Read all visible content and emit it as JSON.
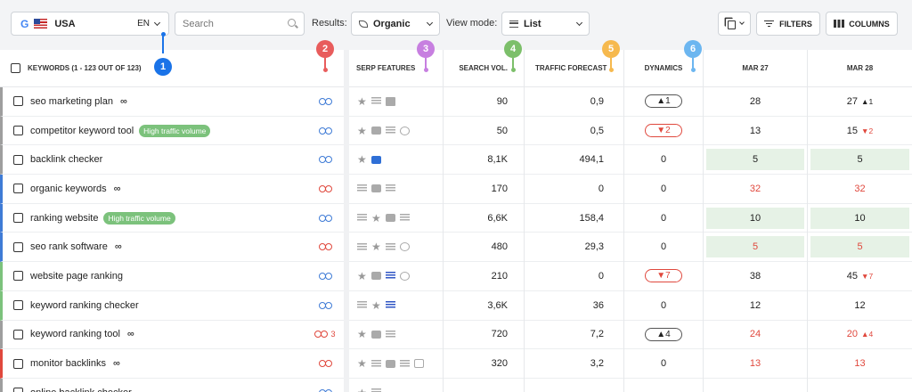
{
  "toolbar": {
    "search_engine_icon": "G",
    "country": "USA",
    "language": "EN",
    "search_placeholder": "Search",
    "results_label": "Results:",
    "results_value": "Organic",
    "view_mode_label": "View mode:",
    "view_mode_value": "List",
    "filters_label": "FILTERS",
    "columns_label": "COLUMNS"
  },
  "markers": [
    "1",
    "2",
    "3",
    "4",
    "5",
    "6"
  ],
  "table": {
    "headers": {
      "keywords": "KEYWORDS (1 - 123 OUT OF 123)",
      "serp": "SERP FEATURES",
      "volume": "SEARCH VOL.",
      "forecast": "TRAFFIC FORECAST",
      "dynamics": "DYNAMICS",
      "date1": "MAR 27",
      "date2": "MAR 28"
    },
    "rows": [
      {
        "keyword": "seo marketing plan",
        "inf": "∞",
        "badge": "",
        "link": "blue",
        "link_count": "",
        "serp": [
          "star",
          "list",
          "img"
        ],
        "volume": "90",
        "forecast": "0,9",
        "dyn": "▲1",
        "dyn_dir": "up",
        "d1": "28",
        "d1_style": "",
        "d2": "27",
        "d2_delta": "▲1",
        "d2_dir": "up",
        "d2_style": "",
        "accent": "#9e9e9e"
      },
      {
        "keyword": "competitor keyword tool",
        "inf": "",
        "badge": "High traffic volume",
        "link": "blue",
        "link_count": "",
        "serp": [
          "star",
          "video",
          "list",
          "circle"
        ],
        "volume": "50",
        "forecast": "0,5",
        "dyn": "▼2",
        "dyn_dir": "down",
        "d1": "13",
        "d1_style": "",
        "d2": "15",
        "d2_delta": "▼2",
        "d2_dir": "down",
        "d2_style": "",
        "accent": "#9e9e9e"
      },
      {
        "keyword": "backlink checker",
        "inf": "",
        "badge": "",
        "link": "blue",
        "link_count": "",
        "serp": [
          "star",
          "videoblue"
        ],
        "volume": "8,1K",
        "forecast": "494,1",
        "dyn": "0",
        "dyn_dir": "",
        "d1": "5",
        "d1_style": "green",
        "d2": "5",
        "d2_delta": "",
        "d2_dir": "",
        "d2_style": "green",
        "accent": "#9e9e9e"
      },
      {
        "keyword": "organic keywords",
        "inf": "∞",
        "badge": "",
        "link": "red",
        "link_count": "",
        "serp": [
          "list",
          "video",
          "list"
        ],
        "volume": "170",
        "forecast": "0",
        "dyn": "0",
        "dyn_dir": "",
        "d1": "32",
        "d1_style": "red",
        "d2": "32",
        "d2_delta": "",
        "d2_dir": "",
        "d2_style": "red",
        "accent": "#3f7bd6"
      },
      {
        "keyword": "ranking website",
        "inf": "",
        "badge": "High traffic volume",
        "link": "blue",
        "link_count": "",
        "serp": [
          "list",
          "star",
          "video",
          "list"
        ],
        "volume": "6,6K",
        "forecast": "158,4",
        "dyn": "0",
        "dyn_dir": "",
        "d1": "10",
        "d1_style": "green",
        "d2": "10",
        "d2_delta": "",
        "d2_dir": "",
        "d2_style": "green",
        "accent": "#3f7bd6"
      },
      {
        "keyword": "seo rank software",
        "inf": "∞",
        "badge": "",
        "link": "red",
        "link_count": "",
        "serp": [
          "list",
          "star",
          "list",
          "circle"
        ],
        "volume": "480",
        "forecast": "29,3",
        "dyn": "0",
        "dyn_dir": "",
        "d1": "5",
        "d1_style": "green red",
        "d2": "5",
        "d2_delta": "",
        "d2_dir": "",
        "d2_style": "green red",
        "accent": "#3f7bd6"
      },
      {
        "keyword": "website page ranking",
        "inf": "",
        "badge": "",
        "link": "blue",
        "link_count": "",
        "serp": [
          "star",
          "video",
          "listblue",
          "circle"
        ],
        "volume": "210",
        "forecast": "0",
        "dyn": "▼7",
        "dyn_dir": "down",
        "d1": "38",
        "d1_style": "",
        "d2": "45",
        "d2_delta": "▼7",
        "d2_dir": "down",
        "d2_style": "",
        "accent": "#7cc27c"
      },
      {
        "keyword": "keyword ranking checker",
        "inf": "",
        "badge": "",
        "link": "blue",
        "link_count": "",
        "serp": [
          "list",
          "star",
          "listblue"
        ],
        "volume": "3,6K",
        "forecast": "36",
        "dyn": "0",
        "dyn_dir": "",
        "d1": "12",
        "d1_style": "",
        "d2": "12",
        "d2_delta": "",
        "d2_dir": "",
        "d2_style": "",
        "accent": "#7cc27c"
      },
      {
        "keyword": "keyword ranking tool",
        "inf": "∞",
        "badge": "",
        "link": "red",
        "link_count": "3",
        "serp": [
          "star",
          "video",
          "list"
        ],
        "volume": "720",
        "forecast": "7,2",
        "dyn": "▲4",
        "dyn_dir": "up",
        "d1": "24",
        "d1_style": "red",
        "d2": "20",
        "d2_delta": "▲4",
        "d2_dir": "up",
        "d2_style": "red",
        "accent": "#9e9e9e"
      },
      {
        "keyword": "monitor backlinks",
        "inf": "∞",
        "badge": "",
        "link": "red",
        "link_count": "",
        "serp": [
          "star",
          "list",
          "video",
          "list",
          "box"
        ],
        "volume": "320",
        "forecast": "3,2",
        "dyn": "0",
        "dyn_dir": "",
        "d1": "13",
        "d1_style": "red",
        "d2": "13",
        "d2_delta": "",
        "d2_dir": "",
        "d2_style": "red",
        "accent": "#e0483d"
      },
      {
        "keyword": "online backlink checker",
        "inf": "",
        "badge": "",
        "link": "blue",
        "link_count": "",
        "serp": [
          "star",
          "list"
        ],
        "volume": "",
        "forecast": "",
        "dyn": "",
        "dyn_dir": "",
        "d1": "",
        "d1_style": "",
        "d2": "",
        "d2_delta": "",
        "d2_dir": "",
        "d2_style": "",
        "accent": "#9e9e9e"
      }
    ]
  },
  "colors": {
    "marker1": "#1a73e8",
    "marker2": "#e85c5c",
    "marker3": "#c77fe0",
    "marker4": "#7cbf6a",
    "marker5": "#f6b94e",
    "marker6": "#6cb6f0"
  }
}
